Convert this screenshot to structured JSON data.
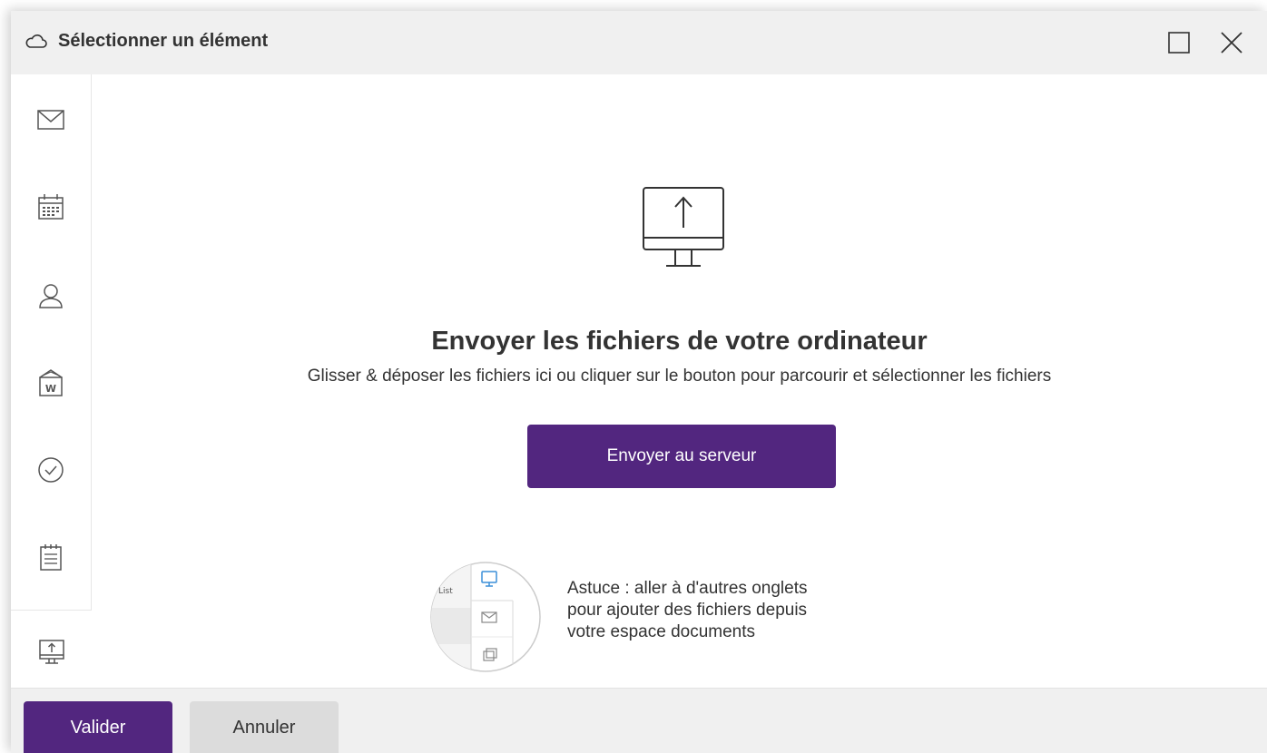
{
  "dialog": {
    "title": "Sélectionner un élément",
    "title_icon": "cloud-icon",
    "maximize_icon": "maximize-icon",
    "close_icon": "close-icon"
  },
  "sidebar": {
    "items": [
      {
        "icon": "mail-icon"
      },
      {
        "icon": "calendar-icon"
      },
      {
        "icon": "contact-icon"
      },
      {
        "icon": "word-document-icon"
      },
      {
        "icon": "task-check-icon"
      },
      {
        "icon": "notes-icon"
      },
      {
        "icon": "computer-upload-icon",
        "active": true
      }
    ]
  },
  "main": {
    "upload_icon": "computer-upload-icon",
    "heading": "Envoyer les fichiers de votre ordinateur",
    "subtext": "Glisser & déposer les fichiers ici ou cliquer sur le bouton pour parcourir et sélectionner les fichiers",
    "send_button": "Envoyer au serveur",
    "tip": {
      "image_label": "List",
      "lines": [
        "Astuce : aller à d'autres onglets",
        "pour ajouter des fichiers depuis",
        "votre espace documents"
      ]
    }
  },
  "footer": {
    "validate_label": "Valider",
    "cancel_label": "Annuler"
  },
  "colors": {
    "accent": "#52267f",
    "titlebar_bg": "#f0f0f0",
    "text": "#333333",
    "icon_stroke": "#555555",
    "tip_icon_blue": "#3b8fd8"
  }
}
